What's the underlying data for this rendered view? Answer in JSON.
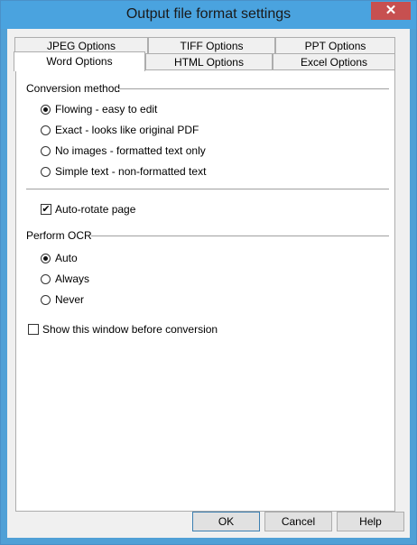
{
  "window": {
    "title": "Output file format settings",
    "close_glyph": "✕"
  },
  "tabs": {
    "back_row": [
      "JPEG Options",
      "TIFF Options",
      "PPT Options"
    ],
    "front_row": [
      "Word Options",
      "HTML Options",
      "Excel Options"
    ],
    "active": "Word Options"
  },
  "conversion": {
    "label": "Conversion method",
    "options": [
      "Flowing - easy to edit",
      "Exact - looks like original PDF",
      "No images - formatted text only",
      "Simple text - non-formatted text"
    ],
    "selected": "Flowing - easy to edit"
  },
  "auto_rotate": {
    "label": "Auto-rotate page",
    "checked": true,
    "check_glyph": "✔"
  },
  "ocr": {
    "label": "Perform OCR",
    "options": [
      "Auto",
      "Always",
      "Never"
    ],
    "selected": "Auto"
  },
  "show_window": {
    "label": "Show this window before conversion",
    "checked": false
  },
  "buttons": {
    "ok": "OK",
    "cancel": "Cancel",
    "help": "Help"
  }
}
